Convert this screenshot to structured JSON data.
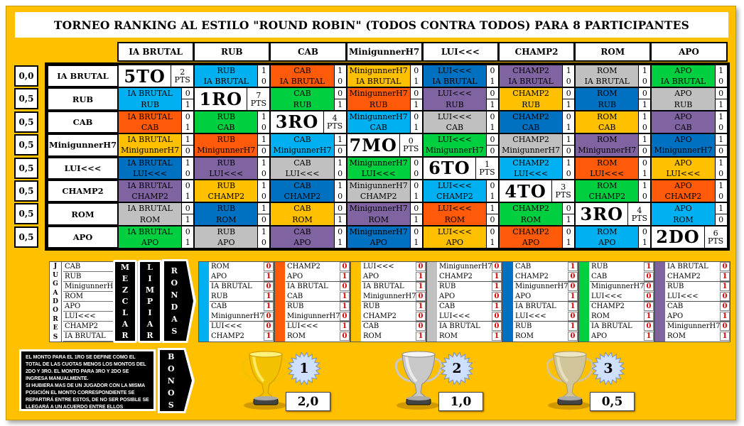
{
  "title": "TORNEO RANKING AL ESTILO \"ROUND ROBIN\" (TODOS CONTRA TODOS) PARA 8 PARTICIPANTES",
  "players": [
    "IA BRUTAL",
    "RUB",
    "CAB",
    "MinigunnerH7",
    "LUI<<<",
    "CHAMP2",
    "ROM",
    "APO"
  ],
  "colors": {
    "background": "#ffc000",
    "cyan": "#00b0f0",
    "orange": "#ff5a0a",
    "yellow": "#ffc000",
    "purple": "#8064a2",
    "blue": "#0070c0",
    "green": "#00d040",
    "gray": "#c0c0c0",
    "points_red": "#e00000"
  },
  "bonus_values": [
    "0,0",
    "0,5",
    "0,5",
    "0,5",
    "0,5",
    "0,5",
    "0,5",
    "0,5"
  ],
  "standings": [
    {
      "rank": "5TO",
      "pts": "2"
    },
    {
      "rank": "1RO",
      "pts": "7"
    },
    {
      "rank": "3RO",
      "pts": "4"
    },
    {
      "rank": "7MO",
      "pts": "0"
    },
    {
      "rank": "6TO",
      "pts": "1"
    },
    {
      "rank": "4TO",
      "pts": "3"
    },
    {
      "rank": "3RO",
      "pts": "4"
    },
    {
      "rank": "2DO",
      "pts": "6"
    }
  ],
  "pts_label": "PTS",
  "matrix": [
    [
      null,
      {
        "top": "RUB",
        "bottom": "IA BRUTAL",
        "s1": "1",
        "s2": "0",
        "color": "cyan"
      },
      {
        "top": "CAB",
        "bottom": "IA BRUTAL",
        "s1": "1",
        "s2": "0",
        "color": "orange"
      },
      {
        "top": "MinigunnerH7",
        "bottom": "IA BRUTAL",
        "s1": "0",
        "s2": "1",
        "color": "yellow"
      },
      {
        "top": "LUI<<<",
        "bottom": "IA BRUTAL",
        "s1": "0",
        "s2": "1",
        "color": "blue"
      },
      {
        "top": "CHAMP2",
        "bottom": "IA BRUTAL",
        "s1": "1",
        "s2": "0",
        "color": "purple"
      },
      {
        "top": "ROM",
        "bottom": "IA BRUTAL",
        "s1": "1",
        "s2": "0",
        "color": "gray"
      },
      {
        "top": "APO",
        "bottom": "IA BRUTAL",
        "s1": "1",
        "s2": "0",
        "color": "green"
      }
    ],
    [
      {
        "top": "IA BRUTAL",
        "bottom": "RUB",
        "s1": "0",
        "s2": "1",
        "color": "cyan"
      },
      null,
      {
        "top": "CAB",
        "bottom": "RUB",
        "s1": "0",
        "s2": "1",
        "color": "green"
      },
      {
        "top": "MinigunnerH7",
        "bottom": "RUB",
        "s1": "0",
        "s2": "1",
        "color": "orange"
      },
      {
        "top": "LUI<<<",
        "bottom": "RUB",
        "s1": "0",
        "s2": "1",
        "color": "purple"
      },
      {
        "top": "CHAMP2",
        "bottom": "RUB",
        "s1": "0",
        "s2": "1",
        "color": "yellow"
      },
      {
        "top": "ROM",
        "bottom": "RUB",
        "s1": "0",
        "s2": "1",
        "color": "blue"
      },
      {
        "top": "APO",
        "bottom": "RUB",
        "s1": "0",
        "s2": "1",
        "color": "gray"
      }
    ],
    [
      {
        "top": "IA BRUTAL",
        "bottom": "CAB",
        "s1": "0",
        "s2": "1",
        "color": "orange"
      },
      {
        "top": "RUB",
        "bottom": "CAB",
        "s1": "1",
        "s2": "0",
        "color": "green"
      },
      null,
      {
        "top": "MinigunnerH7",
        "bottom": "CAB",
        "s1": "0",
        "s2": "1",
        "color": "cyan"
      },
      {
        "top": "LUI<<<",
        "bottom": "CAB",
        "s1": "0",
        "s2": "1",
        "color": "gray"
      },
      {
        "top": "CHAMP2",
        "bottom": "CAB",
        "s1": "0",
        "s2": "1",
        "color": "blue"
      },
      {
        "top": "ROM",
        "bottom": "CAB",
        "s1": "1",
        "s2": "0",
        "color": "yellow"
      },
      {
        "top": "APO",
        "bottom": "CAB",
        "s1": "1",
        "s2": "0",
        "color": "purple"
      }
    ],
    [
      {
        "top": "IA BRUTAL",
        "bottom": "MinigunnerH7",
        "s1": "1",
        "s2": "0",
        "color": "yellow"
      },
      {
        "top": "RUB",
        "bottom": "MinigunnerH7",
        "s1": "1",
        "s2": "0",
        "color": "orange"
      },
      {
        "top": "CAB",
        "bottom": "MinigunnerH7",
        "s1": "1",
        "s2": "0",
        "color": "cyan"
      },
      null,
      {
        "top": "LUI<<<",
        "bottom": "MinigunnerH7",
        "s1": "0",
        "s2": "0",
        "color": "green"
      },
      {
        "top": "CHAMP2",
        "bottom": "MinigunnerH7",
        "s1": "1",
        "s2": "0",
        "color": "gray"
      },
      {
        "top": "ROM",
        "bottom": "MinigunnerH7",
        "s1": "1",
        "s2": "0",
        "color": "purple"
      },
      {
        "top": "APO",
        "bottom": "MinigunnerH7",
        "s1": "1",
        "s2": "0",
        "color": "blue"
      }
    ],
    [
      {
        "top": "IA BRUTAL",
        "bottom": "LUI<<<",
        "s1": "1",
        "s2": "0",
        "color": "blue"
      },
      {
        "top": "RUB",
        "bottom": "LUI<<<",
        "s1": "1",
        "s2": "0",
        "color": "purple"
      },
      {
        "top": "CAB",
        "bottom": "LUI<<<",
        "s1": "1",
        "s2": "0",
        "color": "gray"
      },
      {
        "top": "MinigunnerH7",
        "bottom": "LUI<<<",
        "s1": "0",
        "s2": "0",
        "color": "green"
      },
      null,
      {
        "top": "CHAMP2",
        "bottom": "LUI<<<",
        "s1": "1",
        "s2": "0",
        "color": "cyan"
      },
      {
        "top": "ROM",
        "bottom": "LUI<<<",
        "s1": "0",
        "s2": "1",
        "color": "orange"
      },
      {
        "top": "APO",
        "bottom": "LUI<<<",
        "s1": "1",
        "s2": "0",
        "color": "yellow"
      }
    ],
    [
      {
        "top": "IA BRUTAL",
        "bottom": "CHAMP2",
        "s1": "0",
        "s2": "1",
        "color": "purple"
      },
      {
        "top": "RUB",
        "bottom": "CHAMP2",
        "s1": "1",
        "s2": "0",
        "color": "yellow"
      },
      {
        "top": "CAB",
        "bottom": "CHAMP2",
        "s1": "1",
        "s2": "0",
        "color": "blue"
      },
      {
        "top": "MinigunnerH7",
        "bottom": "CHAMP2",
        "s1": "0",
        "s2": "1",
        "color": "gray"
      },
      {
        "top": "LUI<<<",
        "bottom": "CHAMP2",
        "s1": "0",
        "s2": "1",
        "color": "cyan"
      },
      null,
      {
        "top": "ROM",
        "bottom": "CHAMP2",
        "s1": "1",
        "s2": "0",
        "color": "green"
      },
      {
        "top": "APO",
        "bottom": "CHAMP2",
        "s1": "1",
        "s2": "0",
        "color": "orange"
      }
    ],
    [
      {
        "top": "IA BRUTAL",
        "bottom": "ROM",
        "s1": "0",
        "s2": "1",
        "color": "gray"
      },
      {
        "top": "RUB",
        "bottom": "ROM",
        "s1": "1",
        "s2": "0",
        "color": "blue"
      },
      {
        "top": "CAB",
        "bottom": "ROM",
        "s1": "0",
        "s2": "1",
        "color": "yellow"
      },
      {
        "top": "MinigunnerH7",
        "bottom": "ROM",
        "s1": "0",
        "s2": "1",
        "color": "purple"
      },
      {
        "top": "LUI<<<",
        "bottom": "ROM",
        "s1": "1",
        "s2": "0",
        "color": "orange"
      },
      {
        "top": "CHAMP2",
        "bottom": "ROM",
        "s1": "0",
        "s2": "1",
        "color": "green"
      },
      null,
      {
        "top": "APO",
        "bottom": "ROM",
        "s1": "1",
        "s2": "0",
        "color": "cyan"
      }
    ],
    [
      {
        "top": "IA BRUTAL",
        "bottom": "APO",
        "s1": "0",
        "s2": "1",
        "color": "green"
      },
      {
        "top": "RUB",
        "bottom": "APO",
        "s1": "1",
        "s2": "0",
        "color": "gray"
      },
      {
        "top": "CAB",
        "bottom": "APO",
        "s1": "0",
        "s2": "1",
        "color": "purple"
      },
      {
        "top": "MinigunnerH7",
        "bottom": "APO",
        "s1": "0",
        "s2": "1",
        "color": "blue"
      },
      {
        "top": "LUI<<<",
        "bottom": "APO",
        "s1": "0",
        "s2": "1",
        "color": "yellow"
      },
      {
        "top": "CHAMP2",
        "bottom": "APO",
        "s1": "0",
        "s2": "1",
        "color": "orange"
      },
      {
        "top": "ROM",
        "bottom": "APO",
        "s1": "0",
        "s2": "1",
        "color": "cyan"
      },
      null
    ]
  ],
  "jugadores": {
    "label": "JUGADORES",
    "list": [
      "CAB",
      "RUB",
      "MinigunnerH7",
      "ROM",
      "APO",
      "LUI<<<",
      "CHAMP2",
      "IA BRUTAL"
    ]
  },
  "buttons": {
    "mezclar": "MEZCLAR",
    "limpiar": "LIMPIAR",
    "rondas": "RONDAS",
    "bonos": "BONOS"
  },
  "rounds": [
    {
      "color": "cyan",
      "rows": [
        [
          "ROM",
          "0"
        ],
        [
          "APO",
          "1"
        ],
        [
          "IA BRUTAL",
          "0"
        ],
        [
          "RUB",
          "1"
        ],
        [
          "CAB",
          "1"
        ],
        [
          "MinigunnerH7",
          "0"
        ],
        [
          "LUI<<<",
          "0"
        ],
        [
          "CHAMP2",
          "1"
        ]
      ]
    },
    {
      "color": "orange",
      "rows": [
        [
          "CHAMP2",
          "0"
        ],
        [
          "APO",
          "1"
        ],
        [
          "IA BRUTAL",
          "0"
        ],
        [
          "CAB",
          "1"
        ],
        [
          "RUB",
          "1"
        ],
        [
          "MinigunnerH7",
          "0"
        ],
        [
          "LUI<<<",
          "1"
        ],
        [
          "ROM",
          "0"
        ]
      ]
    },
    {
      "color": "yellow",
      "rows": [
        [
          "LUI<<<",
          "0"
        ],
        [
          "APO",
          "1"
        ],
        [
          "IA BRUTAL",
          "1"
        ],
        [
          "MinigunnerH7",
          "0"
        ],
        [
          "RUB",
          "1"
        ],
        [
          "CHAMP2",
          "0"
        ],
        [
          "CAB",
          "0"
        ],
        [
          "ROM",
          "1"
        ]
      ]
    },
    {
      "color": "gray",
      "rows": [
        [
          "MinigunnerH7",
          "0"
        ],
        [
          "CHAMP2",
          "1"
        ],
        [
          "RUB",
          "1"
        ],
        [
          "APO",
          "0"
        ],
        [
          "CAB",
          "1"
        ],
        [
          "LUI<<<",
          "0"
        ],
        [
          "IA BRUTAL",
          "0"
        ],
        [
          "ROM",
          "1"
        ]
      ]
    },
    {
      "color": "blue",
      "rows": [
        [
          "CAB",
          "1"
        ],
        [
          "CHAMP2",
          "0"
        ],
        [
          "MinigunnerH7",
          "0"
        ],
        [
          "APO",
          "1"
        ],
        [
          "IA BRUTAL",
          "1"
        ],
        [
          "LUI<<<",
          "0"
        ],
        [
          "RUB",
          "1"
        ],
        [
          "ROM",
          "0"
        ]
      ]
    },
    {
      "color": "green",
      "rows": [
        [
          "RUB",
          "1"
        ],
        [
          "CAB",
          "0"
        ],
        [
          "MinigunnerH7",
          "0"
        ],
        [
          "LUI<<<",
          "0"
        ],
        [
          "CHAMP2",
          "0"
        ],
        [
          "ROM",
          "1"
        ],
        [
          "IA BRUTAL",
          "0"
        ],
        [
          "APO",
          "1"
        ]
      ]
    },
    {
      "color": "purple",
      "rows": [
        [
          "IA BRUTAL",
          "0"
        ],
        [
          "CHAMP2",
          "1"
        ],
        [
          "RUB",
          "1"
        ],
        [
          "LUI<<<",
          "0"
        ],
        [
          "CAB",
          "0"
        ],
        [
          "APO",
          "1"
        ],
        [
          "MinigunnerH7",
          "0"
        ],
        [
          "ROM",
          "1"
        ]
      ]
    }
  ],
  "note": "EL MONTO PARA EL 1RO SE DEFINE COMO EL TOTAL DE LAS CUOTAS MENOS LOS MONTOS DEL 2DO Y 3RO. EL MONTO PARA 3RO Y 2DO SE INGRESA MANUALMENTE.\nSI HUBIERA MAS DE UN JUGADOR CON LA MISMA POSICIÓN EL MONTO CORRESPONDIENTE SE REPARTIRÁ ENTRE ESTOS, DE NO SER POSIBLE SE LLEGARÁ A UN ACUERDO ENTRE ELLOS",
  "prizes": [
    {
      "place": "1",
      "amount": "2,0",
      "trophy": "gold"
    },
    {
      "place": "2",
      "amount": "1,0",
      "trophy": "silver"
    },
    {
      "place": "3",
      "amount": "0,5",
      "trophy": "bronze"
    }
  ]
}
